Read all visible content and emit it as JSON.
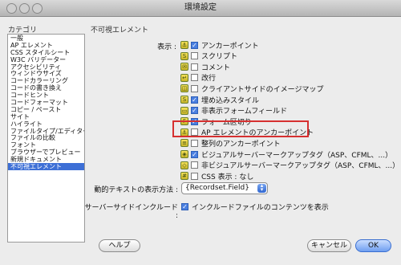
{
  "window": {
    "title": "環境設定"
  },
  "categories": {
    "heading": "カテゴリ",
    "items": [
      "一般",
      "AP エレメント",
      "CSS スタイルシート",
      "W3C バリデーター",
      "アクセシビリティ",
      "ウィンドウサイズ",
      "コードカラーリング",
      "コードの書き換え",
      "コードヒント",
      "コードフォーマット",
      "コピー / ペースト",
      "サイト",
      "ハイライト",
      "ファイルタイプ/エディター",
      "ファイルの比較",
      "フォント",
      "ブラウザーでプレビュー",
      "新規ドキュメント",
      "不可視エレメント"
    ],
    "selected_index": 18
  },
  "panel": {
    "heading": "不可視エレメント",
    "show_label": "表示 :",
    "options": [
      {
        "label": "アンカーポイント",
        "checked": true,
        "icon": "anchor-icon"
      },
      {
        "label": "スクリプト",
        "checked": false,
        "icon": "script-icon"
      },
      {
        "label": "コメント",
        "checked": false,
        "icon": "comment-icon"
      },
      {
        "label": "改行",
        "checked": false,
        "icon": "line-break-icon"
      },
      {
        "label": "クライアントサイドのイメージマップ",
        "checked": false,
        "icon": "image-map-icon"
      },
      {
        "label": "埋め込みスタイル",
        "checked": true,
        "icon": "embedded-style-icon"
      },
      {
        "label": "非表示フォームフィールド",
        "checked": true,
        "icon": "hidden-field-icon"
      },
      {
        "label": "フォーム区切り",
        "checked": true,
        "icon": "form-delimiter-icon"
      },
      {
        "label": "AP エレメントのアンカーポイント",
        "checked": false,
        "icon": "ap-anchor-icon"
      },
      {
        "label": "整列のアンカーポイント",
        "checked": false,
        "icon": "align-anchor-icon"
      },
      {
        "label": "ビジュアルサーバーマークアップタグ（ASP、CFML、...）",
        "checked": true,
        "icon": "server-markup-icon"
      },
      {
        "label": "非ビジュアルサーバーマークアップタグ（ASP、CFML、...）",
        "checked": false,
        "icon": "nonvisual-markup-icon"
      },
      {
        "label": "CSS 表示 : なし",
        "checked": false,
        "icon": "css-display-none-icon"
      }
    ],
    "dynamic_text_label": "動的テキストの表示方法 :",
    "dynamic_text_value": "{Recordset.Field}",
    "server_include_label": "サーバーサイドインクルード :",
    "server_include_option": "インクルードファイルのコンテンツを表示",
    "server_include_checked": true
  },
  "buttons": {
    "help": "ヘルプ",
    "cancel": "キャンセル",
    "ok": "OK"
  },
  "colors": {
    "highlight": "#d63030",
    "selection": "#3d6fd6",
    "check": "#4a7fe0"
  }
}
